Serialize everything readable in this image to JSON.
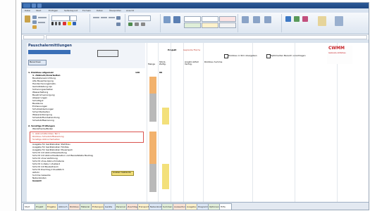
{
  "app": {
    "title": "Pauschalermittlungen",
    "ribbon_tabs": [
      "Datei",
      "Start",
      "Einfügen",
      "Seitenlayout",
      "Formeln",
      "Daten",
      "Überprüfen",
      "Ansicht"
    ],
    "sheet_title": "Pauschalermittlungen",
    "brand": "CWMM",
    "brand_sub": "Gebäude Abfallbau",
    "button_calc": "Berechnen",
    "label_projekt": "Projekt",
    "field_projekt": "Geplante Fläche",
    "header_cols": [
      "Menge",
      "Stück- Zeitlg.",
      "Ansatz Abfall Verfüg.",
      "Rückbau Summe",
      "in %",
      "in %"
    ],
    "checkbox_label": "Rückbau in Std. übergeben",
    "checkbox2_label": "Optimierten Bereich vorschlagen"
  },
  "sections": [
    {
      "title": "1. Rückbau allgemein",
      "value_a": "120",
      "value_b": "80",
      "subtitle": "1. Abbruch/Vorarbeiten",
      "rows": [
        "Baustelleneinrichtung",
        "Alte Bauentsorgung",
        "Handsicherungsmaßn.",
        "Gerüststellung kpl.",
        "Sicherungsarbeiten",
        "Wasserhaltung",
        "Baustromversorgung",
        "Absperrungen",
        "Schnittgut",
        "Bauzäune",
        "Einhausungen",
        "Schutzabdeckungen",
        "Schachtarbeiten",
        "Wasserentsorgung",
        "Schadstoffvorbehandlung",
        "Schadstoffsanierung"
      ]
    },
    {
      "title": "2. Sonstige Prüfungen",
      "subtitle": "Wand/Decke/Boden",
      "highlight_rows": [
        "1. Abbruch/Rückbau Teil 1",
        "Rückbau Schadstoffbelastung",
        "Sonstige Abbrucharbeiten"
      ],
      "rows": [
        "Ausgabe für Gerätekosten Stahlbau",
        "Ausgabe für Gerätekosten Holzbau",
        "Ausgabe für Gerätekosten Mauerwerk",
        "Schicht mit Abbruchbearbeitung",
        "Schicht mit Abbruchkalkulation und Bauleitstelle Bautrag",
        "Schicht ohne Verfüllung",
        "Schicht ohne Abbruchmaterial",
        "Schicht in Zeile 1 Zustand",
        "Schicht mit Bauzeitraum",
        "Schicht Zuschlag 2 Zusätzlich",
        "Abfuhr",
        "Summe Gewerke",
        "Nebenkosten",
        "Gesamt"
      ],
      "yellow_button": "Ausbau Gebäude"
    }
  ],
  "sheet_tabs": [
    "Start",
    "Projekt",
    "Eingabe",
    "Abbruch",
    "Rückbau",
    "Material",
    "Entsorgung",
    "Geräte",
    "Personal",
    "Zuschläge",
    "Transport",
    "Nebenkosten",
    "Summen",
    "Auswertung",
    "Ausgabe",
    "Diagramm",
    "Optionen",
    "Hilfe"
  ],
  "colors": {
    "accent": "#1f5fae",
    "orange": "#f2b26d",
    "yellow": "#f3e07a",
    "highlight_border": "#d9534f",
    "red_text": "#c43a2c",
    "brand_red": "#c61f25"
  }
}
